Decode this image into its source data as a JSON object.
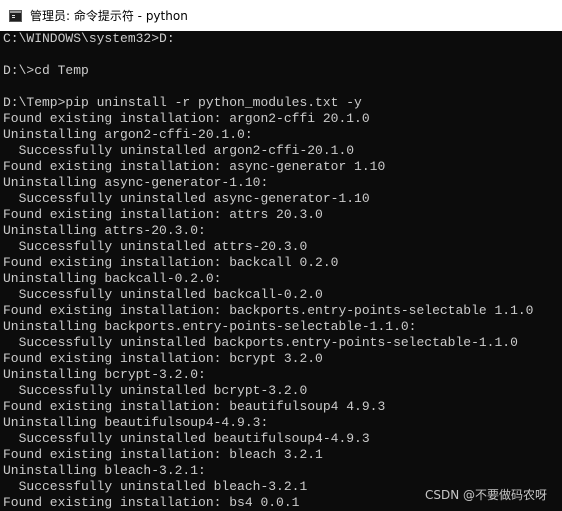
{
  "window": {
    "title": "管理员: 命令提示符 - python",
    "icon": "cmd-icon"
  },
  "colors": {
    "background": "#0c0c0c",
    "text": "#cccccc",
    "titlebar": "#ffffff"
  },
  "console": {
    "lines": [
      "C:\\WINDOWS\\system32>D:",
      "",
      "D:\\>cd Temp",
      "",
      "D:\\Temp>pip uninstall -r python_modules.txt -y",
      "Found existing installation: argon2-cffi 20.1.0",
      "Uninstalling argon2-cffi-20.1.0:",
      "  Successfully uninstalled argon2-cffi-20.1.0",
      "Found existing installation: async-generator 1.10",
      "Uninstalling async-generator-1.10:",
      "  Successfully uninstalled async-generator-1.10",
      "Found existing installation: attrs 20.3.0",
      "Uninstalling attrs-20.3.0:",
      "  Successfully uninstalled attrs-20.3.0",
      "Found existing installation: backcall 0.2.0",
      "Uninstalling backcall-0.2.0:",
      "  Successfully uninstalled backcall-0.2.0",
      "Found existing installation: backports.entry-points-selectable 1.1.0",
      "Uninstalling backports.entry-points-selectable-1.1.0:",
      "  Successfully uninstalled backports.entry-points-selectable-1.1.0",
      "Found existing installation: bcrypt 3.2.0",
      "Uninstalling bcrypt-3.2.0:",
      "  Successfully uninstalled bcrypt-3.2.0",
      "Found existing installation: beautifulsoup4 4.9.3",
      "Uninstalling beautifulsoup4-4.9.3:",
      "  Successfully uninstalled beautifulsoup4-4.9.3",
      "Found existing installation: bleach 3.2.1",
      "Uninstalling bleach-3.2.1:",
      "  Successfully uninstalled bleach-3.2.1",
      "Found existing installation: bs4 0.0.1"
    ]
  },
  "watermark": {
    "text": "CSDN @不要做码农呀"
  }
}
